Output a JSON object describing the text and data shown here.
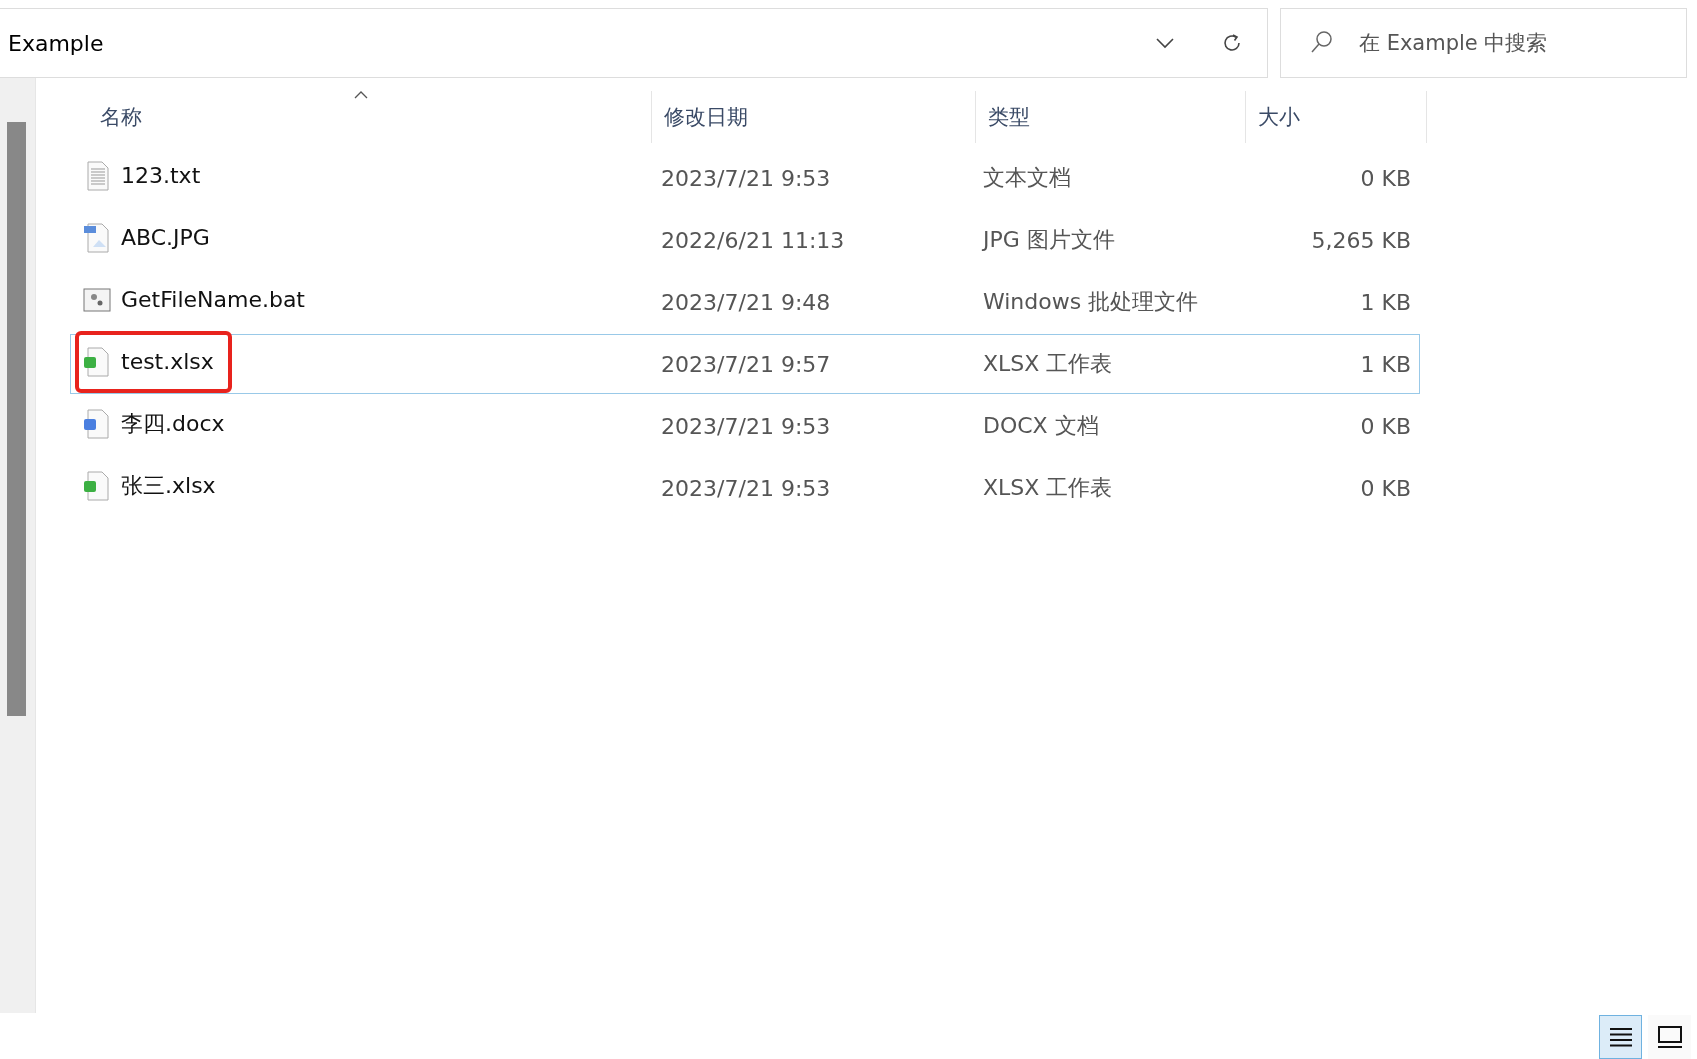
{
  "address_bar": {
    "path": "Example"
  },
  "search": {
    "placeholder": "在 Example 中搜索"
  },
  "columns": [
    {
      "label": "名称",
      "sorted": true
    },
    {
      "label": "修改日期",
      "sorted": false
    },
    {
      "label": "类型",
      "sorted": false
    },
    {
      "label": "大小",
      "sorted": false
    }
  ],
  "files": [
    {
      "name": "123.txt",
      "kind": "text",
      "modified": "2023/7/21 9:53",
      "type": "文本文档",
      "size": "0 KB",
      "selected": false,
      "highlighted": false
    },
    {
      "name": "ABC.JPG",
      "kind": "image",
      "modified": "2022/6/21 11:13",
      "type": "JPG 图片文件",
      "size": "5,265 KB",
      "selected": false,
      "highlighted": false
    },
    {
      "name": "GetFileName.bat",
      "kind": "batch",
      "modified": "2023/7/21 9:48",
      "type": "Windows 批处理文件",
      "size": "1 KB",
      "selected": false,
      "highlighted": false
    },
    {
      "name": "test.xlsx",
      "kind": "sheet",
      "modified": "2023/7/21 9:57",
      "type": "XLSX 工作表",
      "size": "1 KB",
      "selected": true,
      "highlighted": true
    },
    {
      "name": "李四.docx",
      "kind": "doc",
      "modified": "2023/7/21 9:53",
      "type": "DOCX 文档",
      "size": "0 KB",
      "selected": false,
      "highlighted": false
    },
    {
      "name": "张三.xlsx",
      "kind": "sheet",
      "modified": "2023/7/21 9:53",
      "type": "XLSX 工作表",
      "size": "0 KB",
      "selected": false,
      "highlighted": false
    }
  ],
  "view_buttons": [
    {
      "kind": "details",
      "selected": true
    },
    {
      "kind": "tiles",
      "selected": false
    }
  ]
}
